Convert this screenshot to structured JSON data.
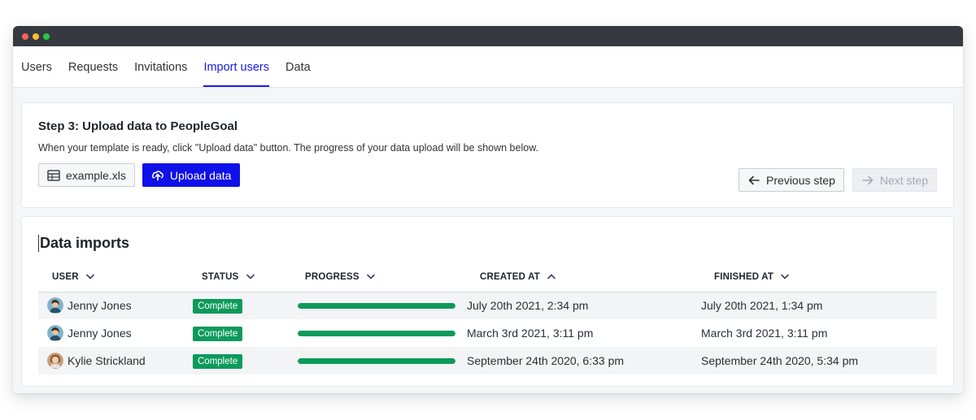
{
  "tabs": [
    {
      "label": "Users",
      "active": false
    },
    {
      "label": "Requests",
      "active": false
    },
    {
      "label": "Invitations",
      "active": false
    },
    {
      "label": "Import users",
      "active": true
    },
    {
      "label": "Data",
      "active": false
    }
  ],
  "step": {
    "title": "Step 3: Upload data to PeopleGoal",
    "description": "When your template is ready, click \"Upload data\" button. The progress of your data upload will be shown below.",
    "file_button_label": "example.xls",
    "upload_button_label": "Upload data",
    "previous_button_label": "Previous step",
    "next_button_label": "Next step",
    "next_disabled": true
  },
  "imports": {
    "title": "Data imports",
    "columns": [
      {
        "label": "USER",
        "sort": "chevron-down-icon"
      },
      {
        "label": "STATUS",
        "sort": "chevron-down-icon"
      },
      {
        "label": "PROGRESS",
        "sort": "chevron-down-icon"
      },
      {
        "label": "CREATED AT",
        "sort": "chevron-up-icon"
      },
      {
        "label": "FINISHED AT",
        "sort": "chevron-down-icon"
      }
    ],
    "rows": [
      {
        "user": "Jenny Jones",
        "avatar": "avatar-jenny",
        "status": "Complete",
        "progress": 1.0,
        "created_at": "July 20th 2021, 2:34 pm",
        "finished_at": "July 20th 2021, 1:34 pm"
      },
      {
        "user": "Jenny Jones",
        "avatar": "avatar-jenny",
        "status": "Complete",
        "progress": 1.0,
        "created_at": "March 3rd 2021, 3:11 pm",
        "finished_at": "March 3rd 2021, 3:11 pm"
      },
      {
        "user": "Kylie Strickland",
        "avatar": "avatar-kylie",
        "status": "Complete",
        "progress": 1.0,
        "created_at": "September 24th 2020, 6:33 pm",
        "finished_at": "September 24th 2020, 5:34 pm"
      }
    ]
  },
  "colors": {
    "accent": "#1010e8",
    "success": "#0d9a5b",
    "titlebar": "#343a40"
  }
}
